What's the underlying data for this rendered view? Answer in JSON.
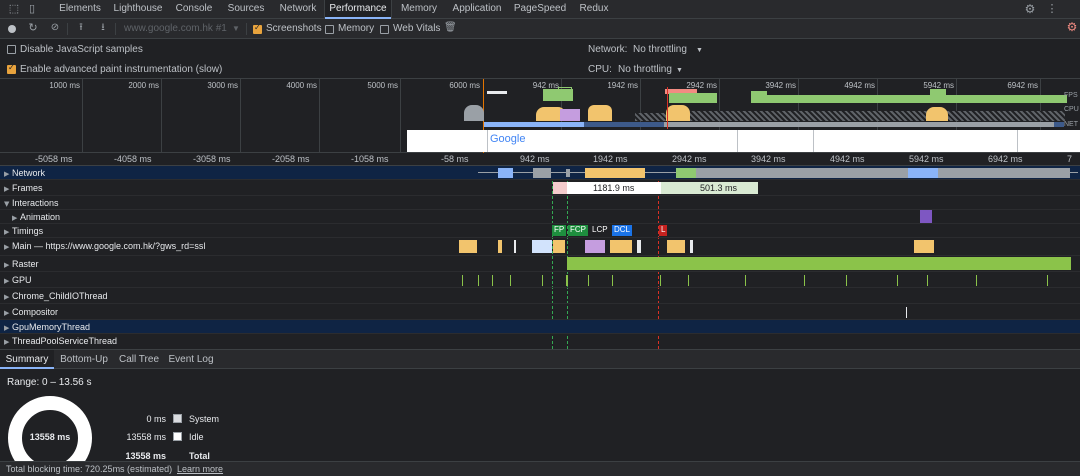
{
  "tabs": [
    {
      "label": "Elements"
    },
    {
      "label": "Lighthouse"
    },
    {
      "label": "Console"
    },
    {
      "label": "Sources"
    },
    {
      "label": "Network"
    },
    {
      "label": "Performance"
    },
    {
      "label": "Memory"
    },
    {
      "label": "Application"
    },
    {
      "label": "PageSpeed"
    },
    {
      "label": "Redux"
    }
  ],
  "active_tab": "Performance",
  "toolbar": {
    "url_select": "www.google.com.hk #1",
    "screenshots_label": "Screenshots",
    "screenshots_checked": true,
    "memory_label": "Memory",
    "memory_checked": false,
    "web_vitals_label": "Web Vitals",
    "web_vitals_checked": false
  },
  "settings": {
    "disable_js_samples": "Disable JavaScript samples",
    "disable_js_samples_checked": false,
    "paint_instrumentation": "Enable advanced paint instrumentation (slow)",
    "paint_instrumentation_checked": true,
    "network_label": "Network:",
    "network_value": "No throttling",
    "cpu_label": "CPU:",
    "cpu_value": "No throttling"
  },
  "overview": {
    "ticks": [
      "1000 ms",
      "2000 ms",
      "3000 ms",
      "4000 ms",
      "5000 ms",
      "6000 ms",
      "942 ms",
      "1942 ms",
      "2942 ms",
      "3942 ms",
      "4942 ms",
      "5942 ms",
      "6942 ms"
    ],
    "lanes": [
      "FPS",
      "CPU",
      "NET"
    ],
    "screenshot_text": "Google"
  },
  "ruler": [
    "-5058 ms",
    "-4058 ms",
    "-3058 ms",
    "-2058 ms",
    "-1058 ms",
    "-58 ms",
    "942 ms",
    "1942 ms",
    "2942 ms",
    "3942 ms",
    "4942 ms",
    "5942 ms",
    "6942 ms",
    "7"
  ],
  "tracks": [
    {
      "label": "Network",
      "arrow": "▶"
    },
    {
      "label": "Frames",
      "arrow": "▶"
    },
    {
      "label": "Interactions",
      "arrow": "▼"
    },
    {
      "label": "Animation",
      "arrow": "▶"
    },
    {
      "label": "Timings",
      "arrow": "▶"
    },
    {
      "label": "Main — https://www.google.com.hk/?gws_rd=ssl",
      "arrow": "▶"
    },
    {
      "label": "Raster",
      "arrow": "▶"
    },
    {
      "label": "GPU",
      "arrow": "▶"
    },
    {
      "label": "Chrome_ChildIOThread",
      "arrow": "▶"
    },
    {
      "label": "Compositor",
      "arrow": "▶"
    },
    {
      "label": "GpuMemoryThread",
      "arrow": "▶"
    },
    {
      "label": "ThreadPoolServiceThread",
      "arrow": "▶"
    }
  ],
  "frames": {
    "frame1": "1181.9 ms",
    "frame2": "501.3 ms"
  },
  "timings": {
    "fp": "FP",
    "fcp": "FCP",
    "lcp": "LCP",
    "dcl": "DCL",
    "l": "L"
  },
  "bottom_tabs": [
    {
      "label": "Summary"
    },
    {
      "label": "Bottom-Up"
    },
    {
      "label": "Call Tree"
    },
    {
      "label": "Event Log"
    }
  ],
  "summary": {
    "range": "Range: 0 – 13.56 s",
    "total_center": "13558 ms",
    "rows": [
      {
        "value": "0 ms",
        "name": "System"
      },
      {
        "value": "13558 ms",
        "name": "Idle"
      },
      {
        "value": "13558 ms",
        "name": "Total"
      }
    ]
  },
  "footer": {
    "blocking_time": "Total blocking time: 720.25ms (estimated)",
    "learn_more": "Learn more"
  },
  "colors": {
    "accent": "#8ab4f8",
    "scripting": "#f2c46d",
    "rendering": "#c59ddf",
    "painting": "#8fc971",
    "loading": "#8ab4f8",
    "raster": "#8bc34a"
  }
}
